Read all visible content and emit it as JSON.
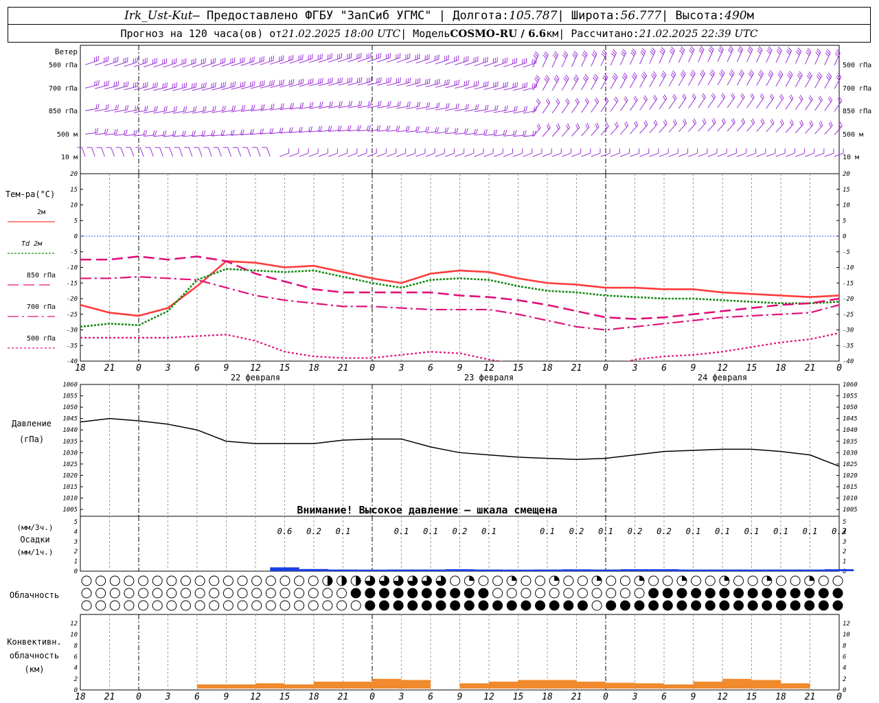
{
  "header": {
    "station": "Irk_Ust-Kut",
    "provider": " – Предоставлено ФГБУ \"ЗапСиб УГМС\" | Долгота: ",
    "lon": "105.787",
    "lat_label": " | Широта: ",
    "lat": "56.777",
    "alt_label": " | Высота: ",
    "alt": "490",
    "alt_unit": "м",
    "fc_label": "Прогноз на 120 часа(ов) от ",
    "fc_start": "21.02.2025 18:00 UTC",
    "model_label": "  | Модель ",
    "model": "COSMO-RU / 6.6",
    "model_unit": "км",
    "calc_label": " | Рассчитано: ",
    "calc_time": "21.02.2025 22:39 UTC"
  },
  "x_ticks": [
    "18",
    "21",
    "0",
    "3",
    "6",
    "9",
    "12",
    "15",
    "18",
    "21",
    "0",
    "3",
    "6",
    "9",
    "12",
    "15",
    "18",
    "21",
    "0",
    "3",
    "6",
    "9",
    "12",
    "15",
    "18",
    "21",
    "0"
  ],
  "dates": [
    "22 февраля",
    "23 февраля",
    "24 февраля"
  ],
  "wind": {
    "title": "Ветер",
    "levels": [
      "500 гПа",
      "700 гПа",
      "850 гПа",
      "500 м",
      "10  м"
    ],
    "color": "#9a2fd6"
  },
  "temperature": {
    "title": "Тем-ра(°С)",
    "ticks": [
      "20",
      "15",
      "10",
      "5",
      "0",
      "-5",
      "-10",
      "-15",
      "-20",
      "-25",
      "-30",
      "-35",
      "-40"
    ],
    "legend": [
      {
        "label": "2м",
        "color": "#ff3b3b",
        "style": "solid"
      },
      {
        "label": "Td  2м",
        "color": "#118a11",
        "style": "dot"
      },
      {
        "label": "850 гПа",
        "color": "#e0107a",
        "style": "dash"
      },
      {
        "label": "700 гПа",
        "color": "#e0107a",
        "style": "dashdot"
      },
      {
        "label": "500 гПа",
        "color": "#e0107a",
        "style": "dotted"
      }
    ]
  },
  "pressure": {
    "title": "Давление",
    "unit": "(гПа)",
    "ticks": [
      "1060",
      "1055",
      "1050",
      "1045",
      "1040",
      "1035",
      "1030",
      "1025",
      "1020",
      "1015",
      "1010",
      "1005"
    ],
    "warning": "Внимание! Высокое давление – шкала смещена"
  },
  "precip": {
    "unit1": "(мм/3ч.)",
    "title": "Осадки",
    "unit2": "(мм/1ч.)",
    "ticks": [
      "5",
      "4",
      "3",
      "2",
      "1",
      "0"
    ],
    "labels": [
      {
        "t": 21,
        "v": "0.6"
      },
      {
        "t": 24,
        "v": "0.2"
      },
      {
        "t": 27,
        "v": "0.1"
      },
      {
        "t": 33,
        "v": "0.1"
      },
      {
        "t": 36,
        "v": "0.1"
      },
      {
        "t": 39,
        "v": "0.2"
      },
      {
        "t": 42,
        "v": "0.1"
      },
      {
        "t": 48,
        "v": "0.1"
      },
      {
        "t": 51,
        "v": "0.2"
      },
      {
        "t": 54,
        "v": "0.1"
      },
      {
        "t": 57,
        "v": "0.2"
      },
      {
        "t": 60,
        "v": "0.2"
      },
      {
        "t": 63,
        "v": "0.1"
      },
      {
        "t": 66,
        "v": "0.1"
      },
      {
        "t": 69,
        "v": "0.1"
      },
      {
        "t": 72,
        "v": "0.1"
      },
      {
        "t": 75,
        "v": "0.1"
      },
      {
        "t": 78,
        "v": "0.2"
      }
    ]
  },
  "cloud": {
    "title": "Облачность"
  },
  "conv": {
    "title1": "Конвективн.",
    "title2": "облачность",
    "unit": "(км)",
    "ticks": [
      "12",
      "10",
      "8",
      "6",
      "4",
      "2",
      "0"
    ]
  },
  "chart_data": [
    {
      "type": "line",
      "title": "Тем-ра(°С)",
      "x_hours_from_start": [
        0,
        3,
        6,
        9,
        12,
        15,
        18,
        21,
        24,
        27,
        30,
        33,
        36,
        39,
        42,
        45,
        48,
        51,
        54,
        57,
        60,
        63,
        66,
        69,
        72,
        75,
        78
      ],
      "ylim": [
        -40,
        20
      ],
      "series": [
        {
          "name": "2м",
          "values": [
            -22,
            -24.5,
            -25.5,
            -23,
            -16,
            -8,
            -8.5,
            -10,
            -9.5,
            -11.5,
            -13.5,
            -15,
            -12,
            -11,
            -11.5,
            -13.5,
            -15,
            -15.5,
            -16.5,
            -16.5,
            -17,
            -17,
            -18,
            -18.5,
            -19,
            -19.5,
            -19
          ]
        },
        {
          "name": "Td  2м",
          "values": [
            -29,
            -28,
            -28.5,
            -24,
            -14,
            -10.5,
            -11,
            -11.5,
            -11,
            -13,
            -15,
            -16.5,
            -14,
            -13.5,
            -14,
            -16,
            -17.5,
            -18,
            -19,
            -19.5,
            -20,
            -20,
            -20.5,
            -21,
            -21.5,
            -21.5,
            -21
          ]
        },
        {
          "name": "850 гПа",
          "values": [
            -7.5,
            -7.5,
            -6.5,
            -7.5,
            -6.5,
            -8,
            -12,
            -14.5,
            -17,
            -18,
            -18,
            -18,
            -18,
            -19,
            -19.5,
            -20.5,
            -22,
            -24,
            -26,
            -26.5,
            -26,
            -25,
            -24,
            -23,
            -22,
            -21.5,
            -20
          ]
        },
        {
          "name": "700 гПа",
          "values": [
            -13.5,
            -13.5,
            -13,
            -13.5,
            -14,
            -16.5,
            -19,
            -20.5,
            -21.5,
            -22.5,
            -22.5,
            -23,
            -23.5,
            -23.5,
            -23.5,
            -25,
            -27,
            -29,
            -30,
            -29,
            -28,
            -27,
            -26,
            -25.5,
            -25,
            -24.5,
            -22
          ]
        },
        {
          "name": "500 гПа",
          "values": [
            -32.5,
            -32.5,
            -32.5,
            -32.5,
            -32,
            -31.5,
            -33.5,
            -37,
            -38.5,
            -39,
            -39,
            -38,
            -37,
            -37.5,
            -39.5,
            -41,
            -42,
            -42.5,
            -42,
            -39.5,
            -38.5,
            -38,
            -37,
            -35.5,
            -34,
            -33,
            -31
          ]
        }
      ]
    },
    {
      "type": "line",
      "title": "Давление",
      "ylabel": "(гПа)",
      "x_hours_from_start": [
        0,
        3,
        6,
        9,
        12,
        15,
        18,
        21,
        24,
        27,
        30,
        33,
        36,
        39,
        42,
        45,
        48,
        51,
        54,
        57,
        60,
        63,
        66,
        69,
        72,
        75,
        78
      ],
      "ylim": [
        1005,
        1060
      ],
      "series": [
        {
          "name": "Давление",
          "values": [
            1043.5,
            1045,
            1044,
            1042.5,
            1040,
            1035,
            1034,
            1034,
            1034,
            1035.5,
            1036,
            1036,
            1032.5,
            1030,
            1029,
            1028,
            1027.5,
            1027,
            1027.5,
            1029,
            1030.5,
            1031,
            1031.5,
            1031.5,
            1030.5,
            1029,
            1024
          ]
        }
      ]
    },
    {
      "type": "bar",
      "title": "Осадки",
      "ylabel": "(мм/1ч.)",
      "ylim": [
        0,
        5
      ],
      "x_hours_from_start": [
        21,
        24,
        27,
        30,
        33,
        36,
        39,
        42,
        45,
        48,
        51,
        54,
        57,
        60,
        63,
        66,
        69,
        72,
        75,
        78
      ],
      "values": [
        0.25,
        0.08,
        0.03,
        0.02,
        0.03,
        0.03,
        0.06,
        0.03,
        0.02,
        0.03,
        0.05,
        0.03,
        0.06,
        0.06,
        0.03,
        0.03,
        0.03,
        0.03,
        0.03,
        0.06
      ]
    },
    {
      "type": "bar",
      "title": "Конвективн. облачность",
      "ylabel": "(км)",
      "ylim": [
        0,
        13
      ],
      "x_hours_from_start": [
        12,
        15,
        18,
        21,
        24,
        27,
        30,
        33,
        36,
        39,
        42,
        45,
        48,
        51,
        54,
        57,
        60,
        63,
        66,
        69,
        72,
        75,
        78
      ],
      "values": [
        1,
        1,
        1.2,
        1,
        1.5,
        1.5,
        2,
        1.8,
        0.2,
        1.2,
        1.5,
        1.8,
        1.8,
        1.5,
        1.3,
        1.2,
        1,
        1.5,
        2,
        1.8,
        1.2,
        0.2,
        0.2
      ]
    }
  ]
}
